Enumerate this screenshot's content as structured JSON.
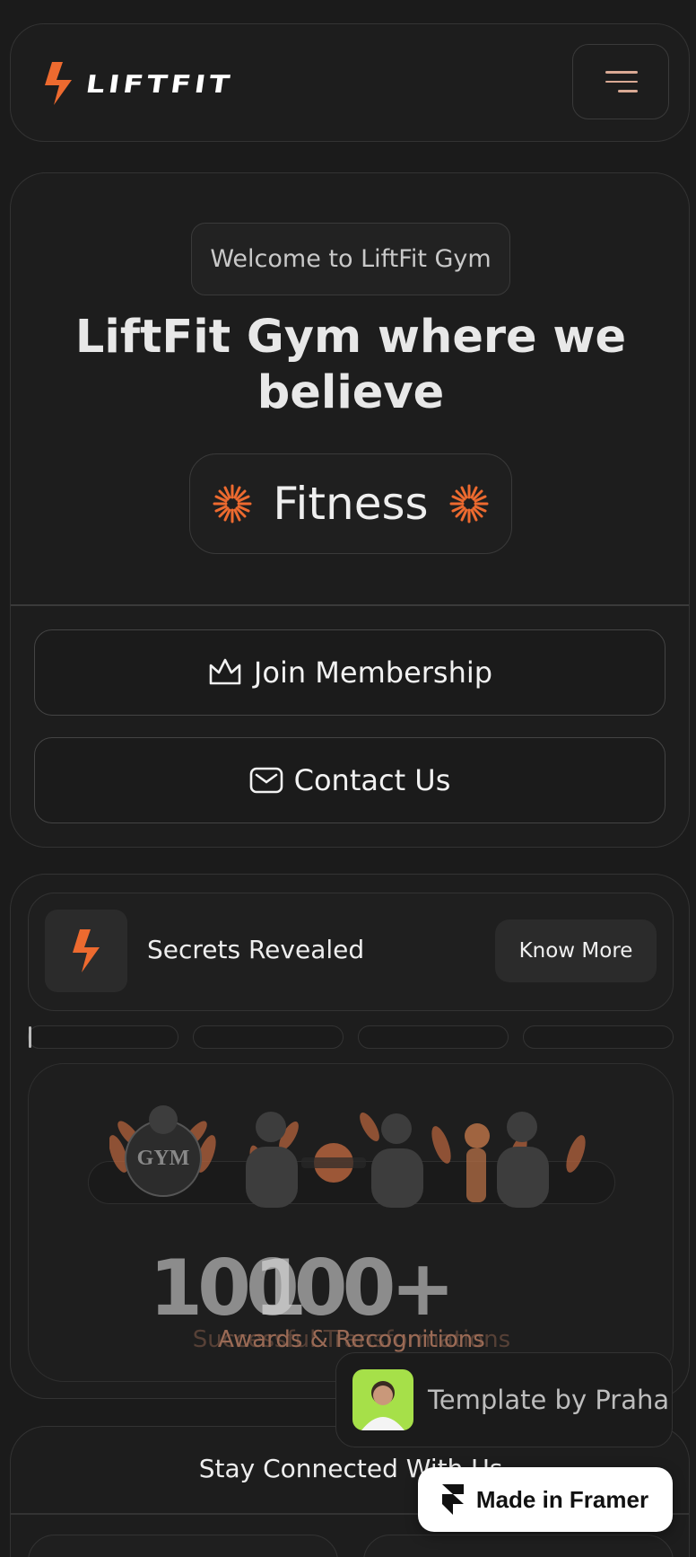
{
  "header": {
    "brand": "LIFTFIT",
    "menu_icon": "hamburger-menu-icon",
    "accent": "#ed6a2f"
  },
  "hero": {
    "welcome": "Welcome to LiftFit Gym",
    "title_line1": "LiftFit Gym where we",
    "title_line2": "believe",
    "rotating_word": "Fitness",
    "join_label": "Join Membership",
    "contact_label": "Contact Us"
  },
  "secrets": {
    "title": "Secrets Revealed",
    "cta": "Know More",
    "progress": [
      0.02,
      0,
      0,
      0
    ]
  },
  "stats": {
    "number": "10000+",
    "number_ghost": "1",
    "label": "Awards & Recognitions",
    "label_ghost": "Successful Transformations"
  },
  "connected": {
    "title": "Stay Connected With Us"
  },
  "badges": {
    "template_by": "Template by Praha",
    "made_in": "Made in Framer"
  }
}
